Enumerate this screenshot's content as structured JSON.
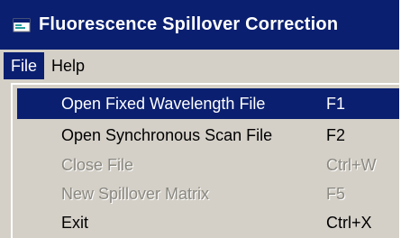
{
  "window": {
    "title": "Fluorescence Spillover Correction",
    "icon": "app-window-icon"
  },
  "menubar": {
    "items": [
      {
        "label": "File"
      },
      {
        "label": "Help"
      }
    ]
  },
  "file_menu": {
    "items": [
      {
        "label": "Open Fixed Wavelength File",
        "shortcut": "F1",
        "state": "highlighted"
      },
      {
        "label": "Open Synchronous Scan File",
        "shortcut": "F2",
        "state": "enabled"
      },
      {
        "label": "Close File",
        "shortcut": "Ctrl+W",
        "state": "disabled"
      },
      {
        "label": "New Spillover Matrix",
        "shortcut": "F5",
        "state": "disabled"
      },
      {
        "label": "Exit",
        "shortcut": "Ctrl+X",
        "state": "enabled"
      }
    ]
  },
  "colors": {
    "title_bar": "#0a1f70",
    "highlight": "#0a1f70",
    "menu_background": "#d4d0c8",
    "disabled_text": "#8a8880"
  }
}
